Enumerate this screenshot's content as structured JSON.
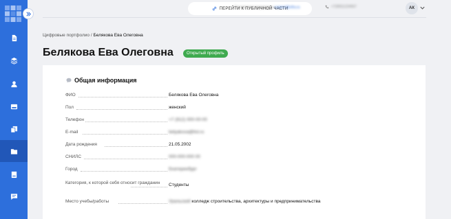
{
  "sidebar": {
    "logo_icon": "app-logo-icon",
    "collapse_icon": "double-chevron-right-icon",
    "items": [
      {
        "name": "document",
        "icon": "document-icon",
        "active": false
      },
      {
        "name": "layers",
        "icon": "layers-icon",
        "active": false
      },
      {
        "name": "profile",
        "icon": "user-icon",
        "active": false
      },
      {
        "name": "inbox",
        "icon": "inbox-icon",
        "active": false
      },
      {
        "name": "copy",
        "icon": "files-icon",
        "active": false
      },
      {
        "name": "portfolio",
        "icon": "folder-icon",
        "active": true
      },
      {
        "name": "book",
        "icon": "book-icon",
        "active": false
      },
      {
        "name": "chat",
        "icon": "chat-icon",
        "active": false
      }
    ],
    "colors": {
      "background": "#2d6fdc",
      "active": "#2157b8"
    }
  },
  "header": {
    "public_button_label": "ПЕРЕЙТИ К ПУБЛИЧНОЙ ЧАСТИ",
    "public_button_icon": "link-icon",
    "support_label": "Техническая поддержка:",
    "support_email": "support@cifra.ru",
    "phone_icon": "phone-icon",
    "phone": "+7(900)1234567",
    "user_initials": "АК",
    "user_menu_icon": "chevron-down-icon"
  },
  "breadcrumb": {
    "parent": "Цифровые портфолио",
    "separator": "/",
    "current": "Белякова Ева Олеговна"
  },
  "profile": {
    "name": "Белякова Ева Олеговна",
    "status": "Открытый профиль",
    "status_color": "#3faa4f"
  },
  "section": {
    "title": "Общая информация",
    "icon": "chat-bubble-icon",
    "fields": {
      "fio": {
        "label": "ФИО",
        "value": "Белякова Ева Олеговна"
      },
      "gender": {
        "label": "Пол",
        "value": "женский"
      },
      "phone": {
        "label": "Телефон",
        "value": "+7 (912) 000-00-00"
      },
      "email": {
        "label": "E-mail",
        "value": "belyakova@list.ru"
      },
      "birth_date": {
        "label": "Дата рождения",
        "value": "21.05.2002"
      },
      "snils": {
        "label": "СНИЛС",
        "value": "000-000-000 00"
      },
      "city": {
        "label": "Город",
        "value": "Екатеринбург"
      },
      "category": {
        "label": "Категория, к которой себя относит гражданин",
        "value": "Студенты"
      },
      "study_place": {
        "label": "Место учебы/работы",
        "value_prefix": "Уральский",
        "value": "колледж строительства, архитектуры и предпринимательства"
      }
    }
  }
}
